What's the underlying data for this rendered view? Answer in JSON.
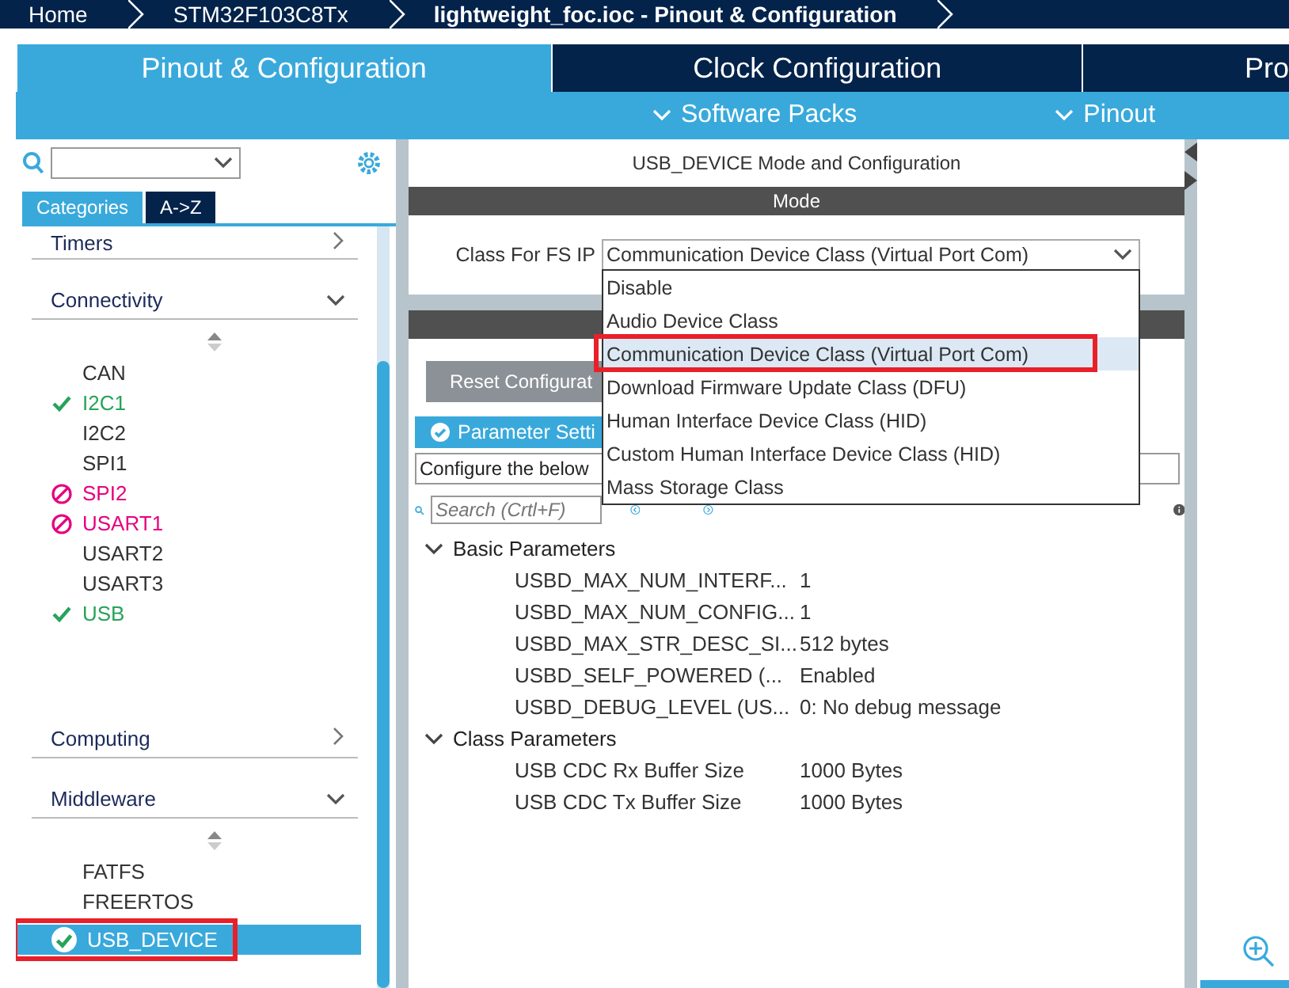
{
  "breadcrumb": [
    {
      "label": "Home",
      "current": false
    },
    {
      "label": "STM32F103C8Tx",
      "current": false
    },
    {
      "label": "lightweight_foc.ioc - Pinout & Configuration",
      "current": true
    }
  ],
  "tabs": [
    {
      "label": "Pinout & Configuration",
      "selected": true
    },
    {
      "label": "Clock Configuration",
      "selected": false
    },
    {
      "label": "Pro",
      "selected": false
    }
  ],
  "subbar": [
    {
      "label": "Software Packs"
    },
    {
      "label": "Pinout"
    }
  ],
  "sidebar": {
    "view_tabs": [
      {
        "label": "Categories",
        "selected": true
      },
      {
        "label": "A->Z",
        "selected": false
      }
    ],
    "categories": [
      {
        "label": "Timers",
        "expanded": false
      },
      {
        "label": "Connectivity",
        "expanded": true,
        "items": [
          {
            "label": "CAN",
            "kind": "none",
            "selected": false,
            "annotated": false
          },
          {
            "label": "I2C1",
            "kind": "ok",
            "selected": false,
            "annotated": false
          },
          {
            "label": "I2C2",
            "kind": "none",
            "selected": false,
            "annotated": false
          },
          {
            "label": "SPI1",
            "kind": "none",
            "selected": false,
            "annotated": false
          },
          {
            "label": "SPI2",
            "kind": "error",
            "selected": false,
            "annotated": false
          },
          {
            "label": "USART1",
            "kind": "error",
            "selected": false,
            "annotated": false
          },
          {
            "label": "USART2",
            "kind": "none",
            "selected": false,
            "annotated": false
          },
          {
            "label": "USART3",
            "kind": "none",
            "selected": false,
            "annotated": false
          },
          {
            "label": "USB",
            "kind": "ok",
            "selected": false,
            "annotated": false
          }
        ]
      },
      {
        "label": "Computing",
        "expanded": false
      },
      {
        "label": "Middleware",
        "expanded": true,
        "items": [
          {
            "label": "FATFS",
            "kind": "none",
            "selected": false,
            "annotated": false
          },
          {
            "label": "FREERTOS",
            "kind": "none",
            "selected": false,
            "annotated": false
          },
          {
            "label": "USB_DEVICE",
            "kind": "configured",
            "selected": true,
            "annotated": true
          }
        ]
      }
    ]
  },
  "panel": {
    "title": "USB_DEVICE Mode and Configuration",
    "mode_header": "Mode",
    "class_field": {
      "label": "Class For FS IP",
      "value": "Communication Device Class (Virtual Port Com)"
    },
    "dropdown": [
      {
        "label": "Disable",
        "selected": false,
        "annotated": false
      },
      {
        "label": "Audio Device Class",
        "selected": false,
        "annotated": false
      },
      {
        "label": "Communication Device Class (Virtual Port Com)",
        "selected": true,
        "annotated": true
      },
      {
        "label": "Download Firmware Update Class (DFU)",
        "selected": false,
        "annotated": false
      },
      {
        "label": "Human Interface Device Class (HID)",
        "selected": false,
        "annotated": false
      },
      {
        "label": "Custom Human Interface Device Class (HID)",
        "selected": false,
        "annotated": false
      },
      {
        "label": "Mass Storage Class",
        "selected": false,
        "annotated": false
      }
    ],
    "reset_button": "Reset Configurat",
    "param_tab": "Parameter Setti",
    "description": "Configure the below",
    "search": {
      "placeholder": "Search (Crtl+F)"
    },
    "groups": [
      {
        "label": "Basic Parameters",
        "expanded": true,
        "children": [
          {
            "name": "USBD_MAX_NUM_INTERF...",
            "value": "1"
          },
          {
            "name": "USBD_MAX_NUM_CONFIG...",
            "value": "1"
          },
          {
            "name": "USBD_MAX_STR_DESC_SI...",
            "value": "512 bytes"
          },
          {
            "name": "USBD_SELF_POWERED (...",
            "value": "Enabled"
          },
          {
            "name": "USBD_DEBUG_LEVEL (US...",
            "value": "0: No debug message"
          }
        ]
      },
      {
        "label": "Class Parameters",
        "expanded": true,
        "children": [
          {
            "name": "USB CDC Rx Buffer Size",
            "value": "1000 Bytes"
          },
          {
            "name": "USB CDC Tx Buffer Size",
            "value": "1000 Bytes"
          }
        ]
      }
    ]
  }
}
